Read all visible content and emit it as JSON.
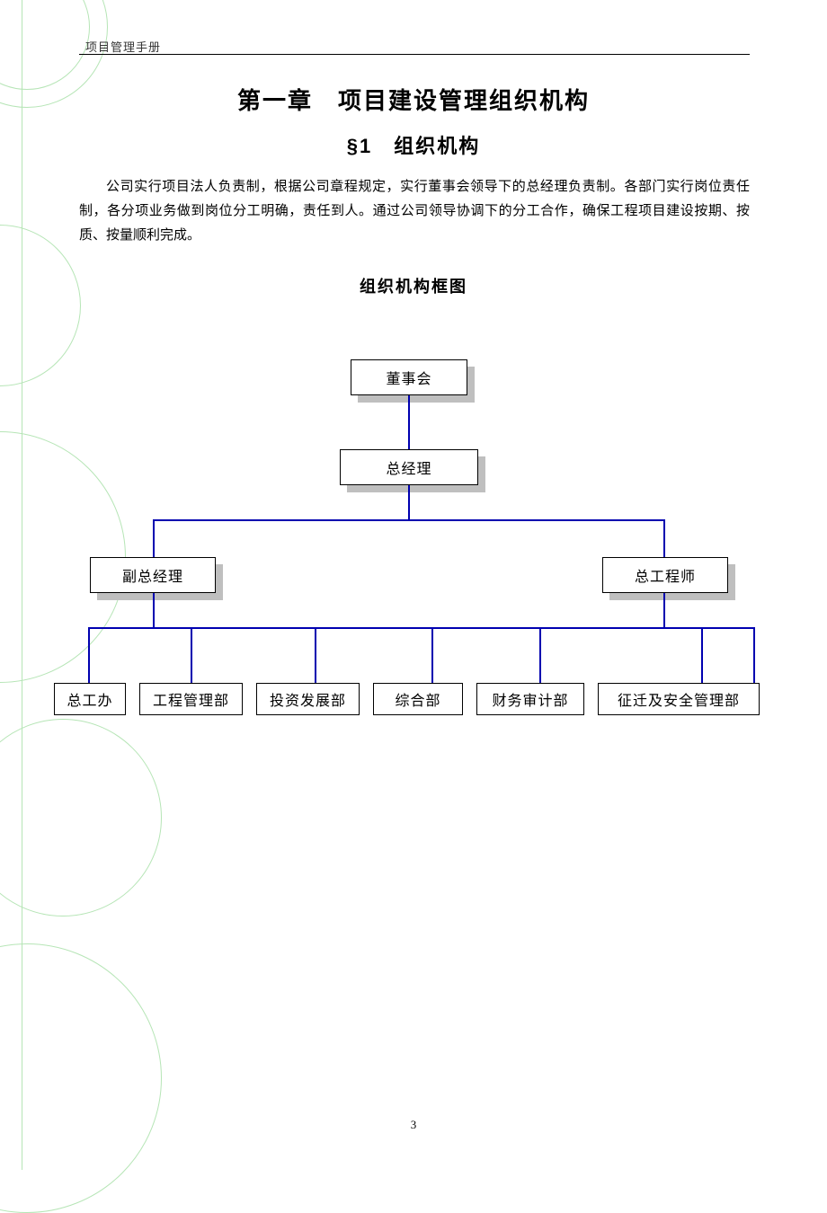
{
  "header": "项目管理手册",
  "title": "第一章　项目建设管理组织机构",
  "subtitle": "§1　组织机构",
  "paragraph": "公司实行项目法人负责制，根据公司章程规定，实行董事会领导下的总经理负责制。各部门实行岗位责任制，各分项业务做到岗位分工明确，责任到人。通过公司领导协调下的分工合作，确保工程项目建设按期、按质、按量顺利完成。",
  "page_number": "3",
  "chart_data": {
    "type": "org",
    "title": "组织机构框图",
    "nodes": {
      "level1": "董事会",
      "level2": "总经理",
      "level3": [
        "副总经理",
        "总工程师"
      ],
      "level4": [
        "总工办",
        "工程管理部",
        "投资发展部",
        "综合部",
        "财务审计部",
        "征迁及安全管理部"
      ]
    }
  }
}
